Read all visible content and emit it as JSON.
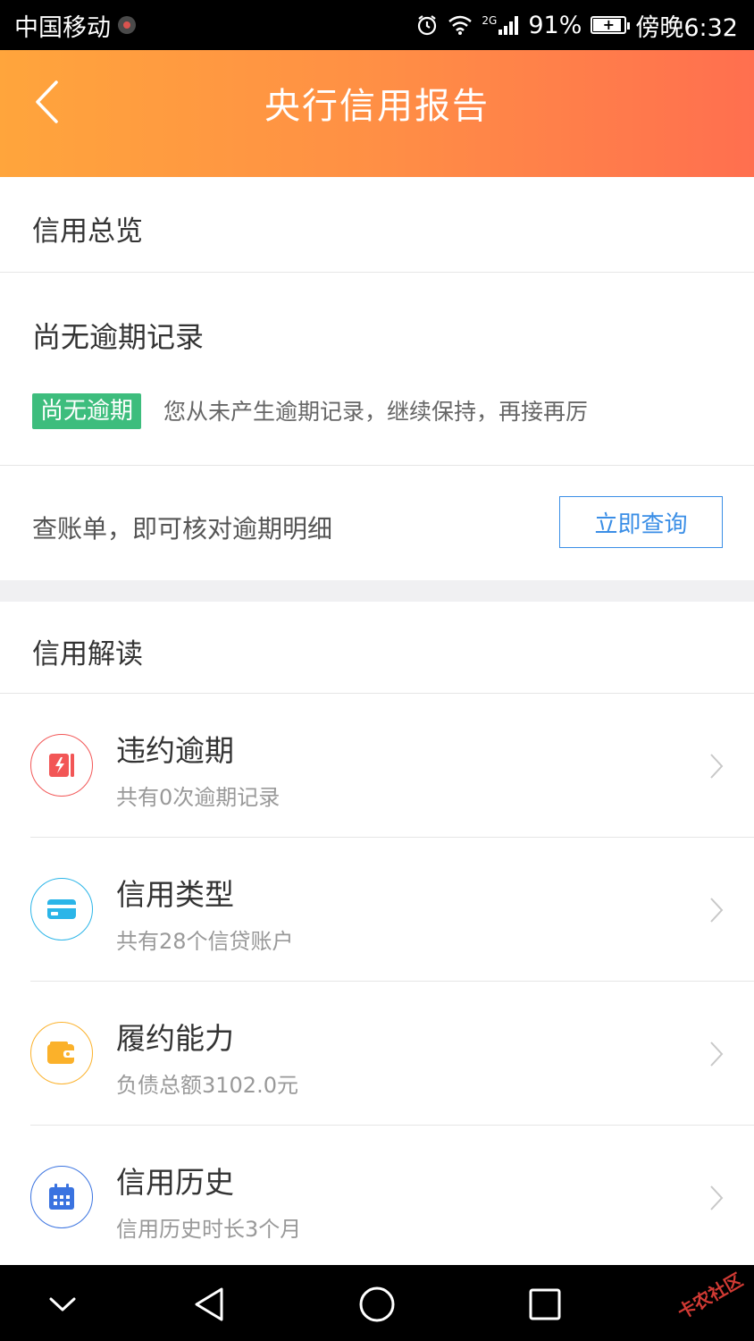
{
  "status_bar": {
    "carrier": "中国移动",
    "network": "2G",
    "battery": "91%",
    "battery_level": 0.91,
    "time": "傍晚6:32"
  },
  "header": {
    "title": "央行信用报告",
    "back_icon": "chevron-left-icon"
  },
  "overview": {
    "section_title": "信用总览",
    "status_title": "尚无逾期记录",
    "badge": "尚无逾期",
    "status_desc": "您从未产生逾期记录，继续保持，再接再厉",
    "bill_text": "查账单，即可核对逾期明细",
    "query_button": "立即查询"
  },
  "interpretation": {
    "section_title": "信用解读",
    "items": [
      {
        "title": "违约逾期",
        "subtitle": "共有0次逾期记录",
        "icon": "overdue-icon",
        "color": "#f25656"
      },
      {
        "title": "信用类型",
        "subtitle": "共有28个信贷账户",
        "icon": "card-icon",
        "color": "#2bb5e8"
      },
      {
        "title": "履约能力",
        "subtitle": "负债总额3102.0元",
        "icon": "wallet-icon",
        "color": "#fbb12a"
      },
      {
        "title": "信用历史",
        "subtitle": "信用历史时长3个月",
        "icon": "calendar-icon",
        "color": "#3a73e0"
      }
    ]
  },
  "watermark": "卡农社区",
  "colors": {
    "header_start": "#ffa53c",
    "header_end": "#ff6f4f",
    "badge_green": "#3dbd7d",
    "link_blue": "#3a8ee6"
  }
}
